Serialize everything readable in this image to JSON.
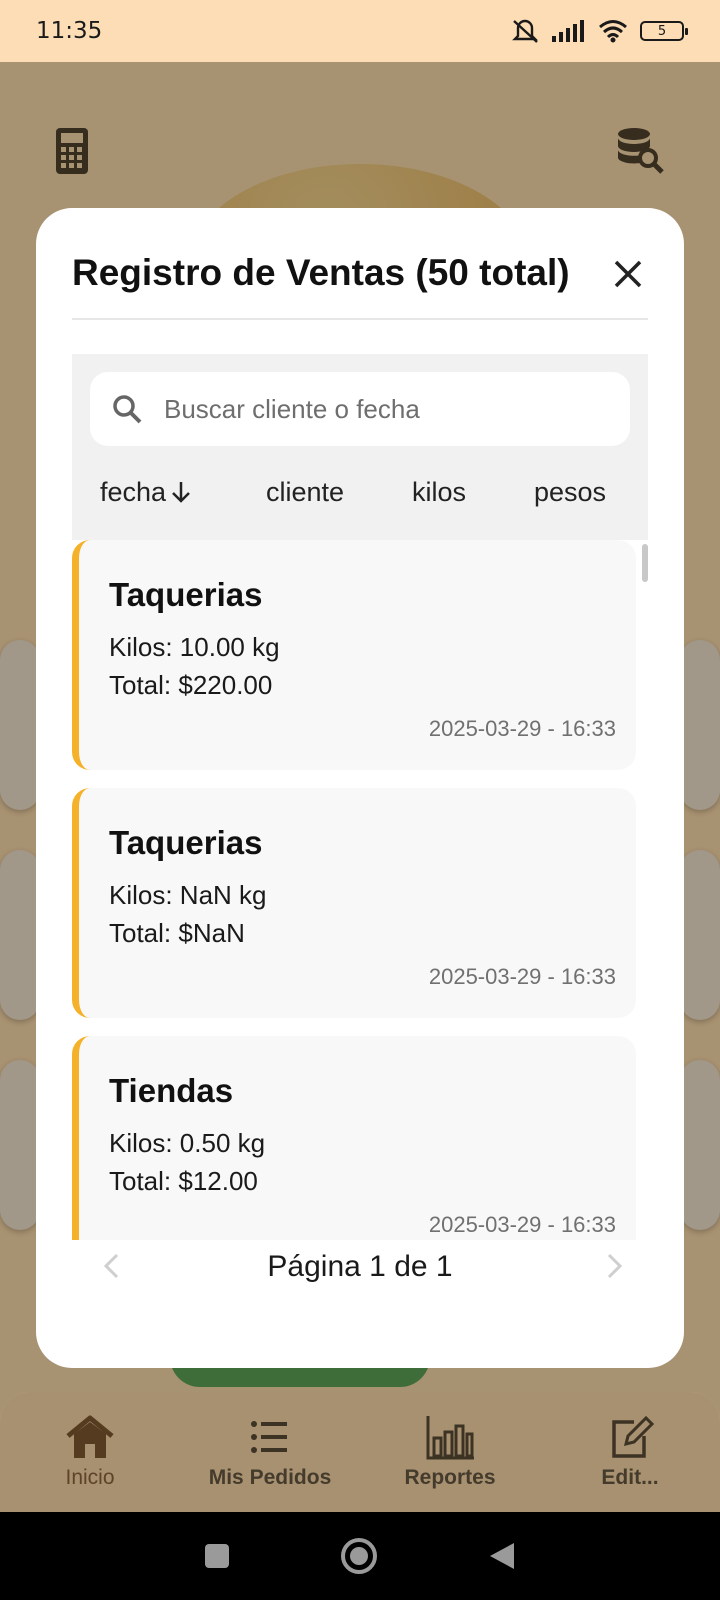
{
  "status_bar": {
    "time": "11:35",
    "battery": "5"
  },
  "modal": {
    "title": "Registro de Ventas (50 total)",
    "search_placeholder": "Buscar cliente o fecha",
    "sort_options": [
      {
        "label": "fecha",
        "active": true
      },
      {
        "label": "cliente",
        "active": false
      },
      {
        "label": "kilos",
        "active": false
      },
      {
        "label": "pesos",
        "active": false
      }
    ],
    "sales": [
      {
        "client": "Taquerias",
        "kilos": "Kilos: 10.00 kg",
        "total": "Total: $220.00",
        "date": "2025-03-29 - 16:33"
      },
      {
        "client": "Taquerias",
        "kilos": "Kilos: NaN kg",
        "total": "Total: $NaN",
        "date": "2025-03-29 - 16:33"
      },
      {
        "client": "Tiendas",
        "kilos": "Kilos: 0.50 kg",
        "total": "Total: $12.00",
        "date": "2025-03-29 - 16:33"
      }
    ],
    "pagination": {
      "label": "Página 1 de 1"
    }
  },
  "bottom_nav": {
    "items": [
      {
        "label": "Inicio",
        "icon": "home-icon",
        "active": true
      },
      {
        "label": "Mis Pedidos",
        "icon": "list-icon",
        "active": false
      },
      {
        "label": "Reportes",
        "icon": "bar-chart-icon",
        "active": false
      },
      {
        "label": "Edit...",
        "icon": "edit-icon",
        "active": false
      }
    ]
  },
  "colors": {
    "accent": "#f5b12a",
    "status_bar": "#fdddb5"
  }
}
